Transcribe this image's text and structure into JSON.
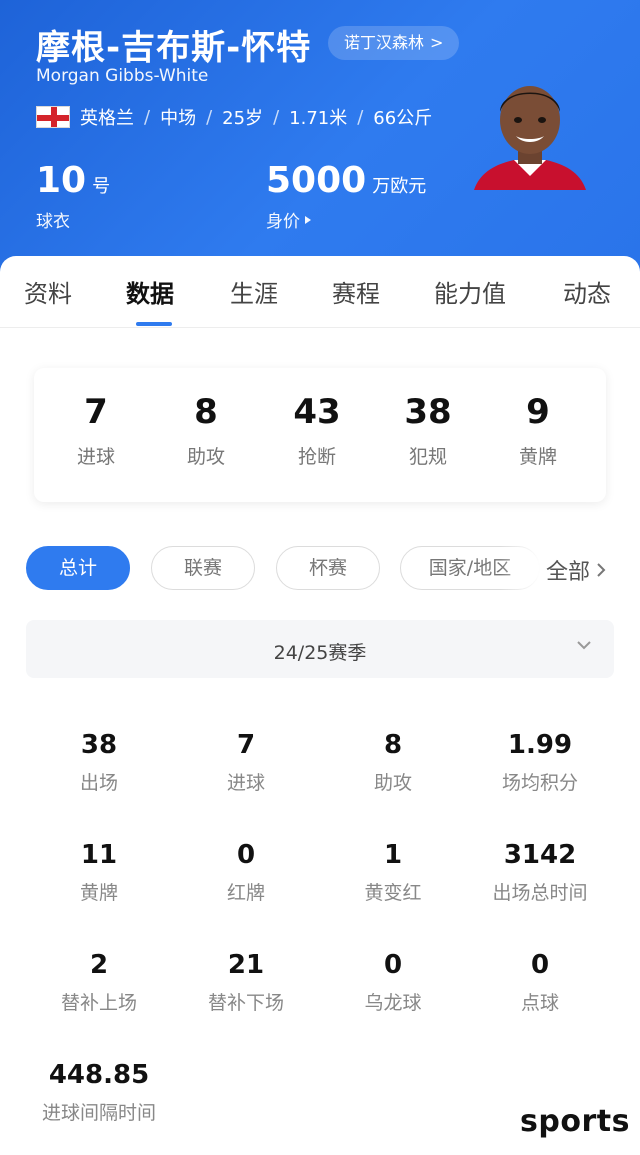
{
  "player": {
    "name_cn": "摩根-吉布斯-怀特",
    "name_en": "Morgan  Gibbs-White",
    "club": "诺丁汉森林",
    "club_arrow": ">",
    "nationality": "英格兰",
    "position": "中场",
    "age": "25岁",
    "height": "1.71米",
    "weight": "66公斤",
    "separator": "/",
    "jersey_number": "10",
    "jersey_unit": "号",
    "jersey_label": "球衣",
    "market_value": "5000",
    "market_value_unit": "万欧元",
    "market_value_label": "身价"
  },
  "tabs": [
    {
      "label": "资料"
    },
    {
      "label": "数据"
    },
    {
      "label": "生涯"
    },
    {
      "label": "赛程"
    },
    {
      "label": "能力值"
    },
    {
      "label": "动态"
    }
  ],
  "active_tab": "数据",
  "summary": [
    {
      "value": "7",
      "label": "进球"
    },
    {
      "value": "8",
      "label": "助攻"
    },
    {
      "value": "43",
      "label": "抢断"
    },
    {
      "value": "38",
      "label": "犯规"
    },
    {
      "value": "9",
      "label": "黄牌"
    }
  ],
  "filters": {
    "chips": [
      {
        "label": "总计"
      },
      {
        "label": "联赛"
      },
      {
        "label": "杯赛"
      },
      {
        "label": "国家/地区"
      }
    ],
    "active": "总计",
    "all_label": "全部"
  },
  "season": {
    "label": "24/25赛季"
  },
  "stats": [
    {
      "value": "38",
      "label": "出场"
    },
    {
      "value": "7",
      "label": "进球"
    },
    {
      "value": "8",
      "label": "助攻"
    },
    {
      "value": "1.99",
      "label": "场均积分"
    },
    {
      "value": "11",
      "label": "黄牌"
    },
    {
      "value": "0",
      "label": "红牌"
    },
    {
      "value": "1",
      "label": "黄变红"
    },
    {
      "value": "3142",
      "label": "出场总时间"
    },
    {
      "value": "2",
      "label": "替补上场"
    },
    {
      "value": "21",
      "label": "替补下场"
    },
    {
      "value": "0",
      "label": "乌龙球"
    },
    {
      "value": "0",
      "label": "点球"
    },
    {
      "value": "448.85",
      "label": "进球间隔时间"
    }
  ],
  "watermark": "sports",
  "colors": {
    "accent": "#2f7bef",
    "header_dark": "#1e63d8",
    "flag_red": "#d4242b"
  }
}
